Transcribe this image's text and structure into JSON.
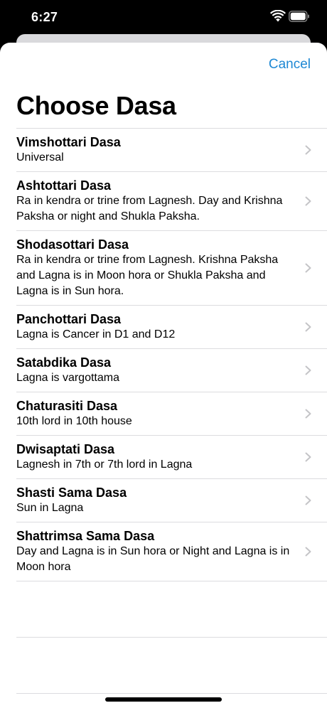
{
  "status_bar": {
    "time": "6:27",
    "wifi_icon": "wifi-icon",
    "battery_icon": "battery-icon"
  },
  "nav": {
    "cancel_label": "Cancel"
  },
  "title": "Choose Dasa",
  "items": [
    {
      "title": "Vimshottari Dasa",
      "subtitle": "Universal"
    },
    {
      "title": "Ashtottari Dasa",
      "subtitle": "Ra in kendra or trine from Lagnesh. Day and Krishna Paksha or night and Shukla Paksha."
    },
    {
      "title": "Shodasottari Dasa",
      "subtitle": "Ra in kendra or trine from Lagnesh. Krishna Paksha and Lagna is in Moon hora or Shukla Paksha and Lagna is in Sun hora."
    },
    {
      "title": "Panchottari Dasa",
      "subtitle": "Lagna is Cancer in D1 and D12"
    },
    {
      "title": "Satabdika Dasa",
      "subtitle": "Lagna is vargottama"
    },
    {
      "title": "Chaturasiti Dasa",
      "subtitle": "10th lord in 10th house"
    },
    {
      "title": "Dwisaptati Dasa",
      "subtitle": "Lagnesh in 7th or 7th lord in Lagna"
    },
    {
      "title": "Shasti Sama Dasa",
      "subtitle": "Sun in Lagna"
    },
    {
      "title": "Shattrimsa Sama Dasa",
      "subtitle": "Day and Lagna is in Sun hora or Night and Lagna is in Moon hora"
    }
  ],
  "colors": {
    "accent": "#1e88d4",
    "separator": "#dcdcdf",
    "chevron": "#c4c4c7"
  }
}
